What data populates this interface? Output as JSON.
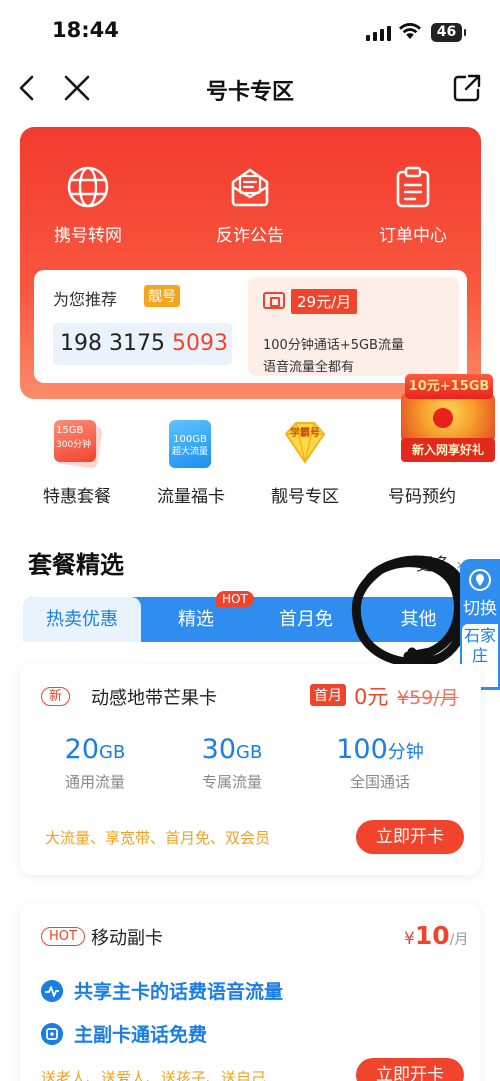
{
  "status": {
    "time": "18:44",
    "battery": "46"
  },
  "nav": {
    "title": "号卡专区"
  },
  "quick_actions": [
    {
      "label": "携号转网",
      "icon": "globe-icon"
    },
    {
      "label": "反诈公告",
      "icon": "envelope-icon"
    },
    {
      "label": "订单中心",
      "icon": "clipboard-icon"
    }
  ],
  "recommend": {
    "label": "为您推荐",
    "tag": "靓号",
    "number_prefix": "198 3175 ",
    "number_highlight": "5093",
    "plan_price": "29元/月",
    "plan_line1": "100分钟通话+5GB流量",
    "plan_line2": "语音流量全都有"
  },
  "gift": {
    "banner": "10元+15GB",
    "ribbon": "新入网享好礼"
  },
  "entries": [
    {
      "label": "特惠套餐",
      "icon": "package-icon",
      "icon_text_top": "15GB",
      "icon_text_bottom": "300分钟"
    },
    {
      "label": "流量福卡",
      "icon": "data-card-icon",
      "icon_text_top": "100GB",
      "icon_text_bottom": "超大流量"
    },
    {
      "label": "靓号专区",
      "icon": "diamond-badge-icon",
      "icon_text_top": "学霸号"
    },
    {
      "label": "号码预约",
      "icon": "gift-box-icon"
    }
  ],
  "section": {
    "title": "套餐精选",
    "more": "更多"
  },
  "tabs": [
    {
      "label": "热卖优惠",
      "active": true
    },
    {
      "label": "精选",
      "active": false,
      "badge": "HOT"
    },
    {
      "label": "首月免",
      "active": false
    },
    {
      "label": "其他",
      "active": false
    }
  ],
  "side_switch": {
    "label": "切换",
    "city": "石家庄"
  },
  "card1": {
    "badge": "新",
    "name": "动感地带芒果卡",
    "first_month": "首月",
    "price_now": "0元",
    "price_old": "¥59/月",
    "stats": [
      {
        "num": "20",
        "unit": "GB",
        "desc": "通用流量"
      },
      {
        "num": "30",
        "unit": "GB",
        "desc": "专属流量"
      },
      {
        "num": "100",
        "unit": "分钟",
        "desc": "全国通话"
      }
    ],
    "features": "大流量、享宽带、首月免、双会员",
    "button": "立即开卡"
  },
  "card2": {
    "badge": "HOT",
    "name": "移动副卡",
    "price_currency": "¥",
    "price_value": "10",
    "price_per": "/月",
    "perks": [
      "共享主卡的话费语音流量",
      "主副卡通话免费"
    ],
    "send": "送老人、送爱人、送孩子、送自己",
    "button": "立即开卡"
  },
  "colors": {
    "brand_red": "#f0442c",
    "brand_blue": "#2f8df0",
    "accent_orange": "#f0a21e"
  }
}
